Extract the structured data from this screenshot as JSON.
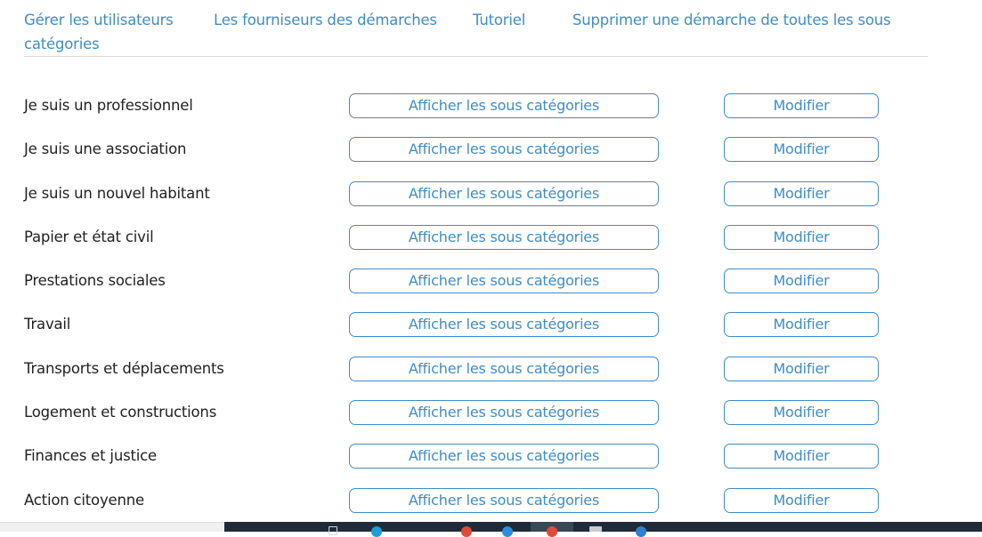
{
  "nav": {
    "links": [
      "Gérer les utilisateurs",
      "Les fourniseurs des démarches",
      "Tutoriel",
      "Supprimer une démarche de toutes les sous",
      "catégories"
    ]
  },
  "categories": [
    {
      "label": "Je suis un professionnel",
      "show_label": "Afficher les sous catégories",
      "edit_label": "Modifier"
    },
    {
      "label": "Je suis une association",
      "show_label": "Afficher les sous catégories",
      "edit_label": "Modifier"
    },
    {
      "label": "Je suis un nouvel habitant",
      "show_label": "Afficher les sous catégories",
      "edit_label": "Modifier"
    },
    {
      "label": "Papier et état civil",
      "show_label": "Afficher les sous catégories",
      "edit_label": "Modifier"
    },
    {
      "label": "Prestations sociales",
      "show_label": "Afficher les sous catégories",
      "edit_label": "Modifier"
    },
    {
      "label": "Travail",
      "show_label": "Afficher les sous catégories",
      "edit_label": "Modifier"
    },
    {
      "label": "Transports et déplacements",
      "show_label": "Afficher les sous catégories",
      "edit_label": "Modifier"
    },
    {
      "label": "Logement et constructions",
      "show_label": "Afficher les sous catégories",
      "edit_label": "Modifier"
    },
    {
      "label": "Finances et justice",
      "show_label": "Afficher les sous catégories",
      "edit_label": "Modifier"
    },
    {
      "label": "Action citoyenne",
      "show_label": "Afficher les sous catégories",
      "edit_label": "Modifier"
    }
  ],
  "colors": {
    "accent": "#3e8dc9",
    "text": "#222222",
    "taskbar": "#1f2b38"
  }
}
